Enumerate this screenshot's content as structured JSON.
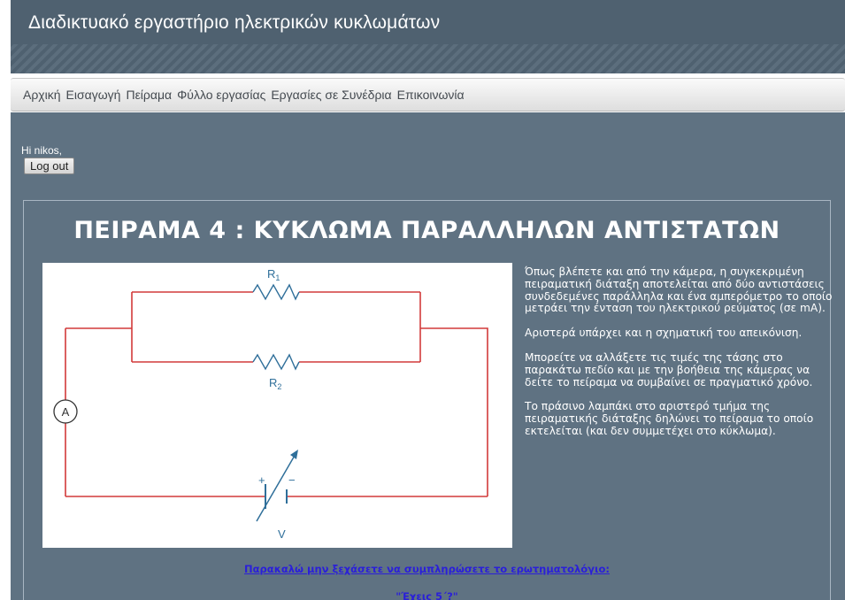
{
  "header": {
    "title": "Διαδικτυακό εργαστήριο ηλεκτρικών κυκλωμάτων"
  },
  "nav": {
    "items": [
      {
        "label": "Αρχική"
      },
      {
        "label": "Εισαγωγή"
      },
      {
        "label": "Πείραμα"
      },
      {
        "label": "Φύλλο εργασίας"
      },
      {
        "label": "Εργασίες σε Συνέδρια"
      },
      {
        "label": "Επικοινωνία"
      }
    ]
  },
  "user": {
    "greeting": "Hi nikos,",
    "logout_label": "Log out"
  },
  "experiment": {
    "title": "ΠΕΙΡΑΜΑ 4 : ΚΥΚΛΩΜΑ ΠΑΡΑΛΛΗΛΩΝ ΑΝΤΙΣΤΑΤΩΝ",
    "diagram": {
      "r1_label": "R",
      "r1_sub": "1",
      "r2_label": "R",
      "r2_sub": "2",
      "ammeter_label": "A",
      "source_label": "V",
      "plus_label": "+",
      "minus_label": "−"
    },
    "paragraphs": [
      "Όπως βλέπετε και από την κάμερα, η συγκεκριμένη πειραματική διάταξη αποτελείται από δύο αντιστάσεις συνδεδεμένες παράλληλα και ένα αμπερόμετρο το οποίο μετράει την ένταση του ηλεκτρικού ρεύματος (σε mA).",
      "Αριστερά υπάρχει και η σχηματική του απεικόνιση.",
      "Μπορείτε να αλλάξετε τις τιμές της τάσης στο παρακάτω πεδίο και με την βοήθεια της κάμερας να δείτε το πείραμα να συμβαίνει σε πραγματικό χρόνο.",
      "Το πράσινο λαμπάκι στο αριστερό τμήμα της πειραματικής διάταξης δηλώνει το πείραμα το οποίο εκτελείται (και δεν συμμετέχει στο κύκλωμα)."
    ],
    "survey_link": "Παρακαλώ μην ξεχάσετε να συμπληρώσετε το ερωτηματολόγιο:",
    "survey_title": "\"Έχεις 5΄?\""
  },
  "colors": {
    "header_bg": "#4f6170",
    "content_bg": "#5f7282",
    "wire": "#d23a3a",
    "component": "#2f6f9a",
    "link": "#2a1fd9"
  }
}
